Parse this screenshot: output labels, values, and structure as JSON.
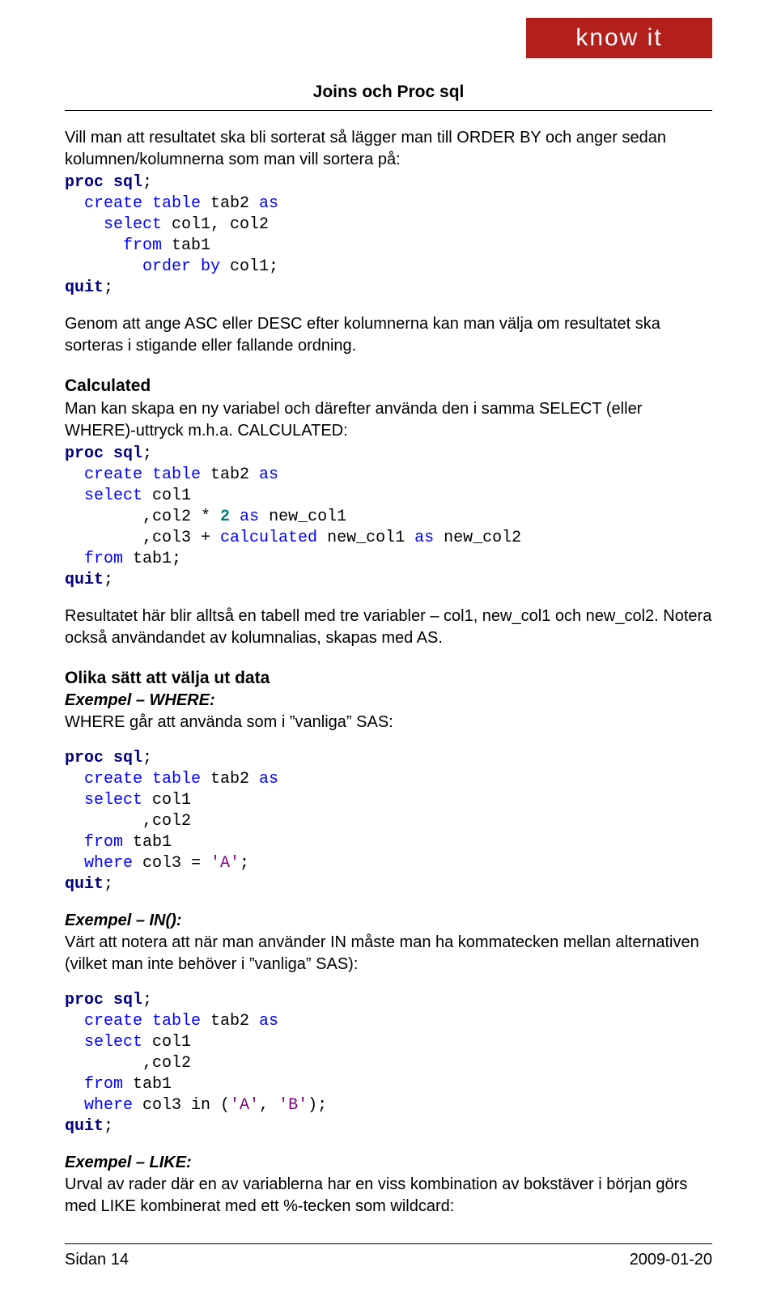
{
  "logo": "know it",
  "header_title": "Joins och Proc sql",
  "intro_para": "Vill man att resultatet ska bli sorterat så lägger man till ORDER BY och anger sedan kolumnen/kolumnerna som man vill sortera på:",
  "code1": {
    "l1a": "proc",
    "l1b": " sql",
    "l1c": ";",
    "l2a": "  create",
    "l2b": " table",
    "l2c": " tab2 ",
    "l2d": "as",
    "l3a": "    select",
    "l3b": " col1, col2",
    "l4a": "      from",
    "l4b": " tab1",
    "l5a": "        order",
    "l5b": " by",
    "l5c": " col1;",
    "l6a": "quit",
    "l6b": ";"
  },
  "para_asc": "Genom att ange ASC eller DESC efter kolumnerna kan man välja om resultatet ska sorteras i stigande eller fallande ordning.",
  "calc_head": "Calculated",
  "calc_para": "Man kan skapa en ny variabel och därefter använda den i samma SELECT (eller WHERE)-uttryck m.h.a. CALCULATED:",
  "code2": {
    "l1a": "proc",
    "l1b": " sql",
    "l1c": ";",
    "l2a": "  create",
    "l2b": " table",
    "l2c": " tab2 ",
    "l2d": "as",
    "l3a": "  select",
    "l3b": " col1",
    "l4a": "        ,col2 * ",
    "l4b": "2",
    "l4c": " as",
    "l4d": " new_col1",
    "l5a": "        ,col3 + ",
    "l5b": "calculated",
    "l5c": " new_col1 ",
    "l5d": "as",
    "l5e": " new_col2",
    "l6a": "  from",
    "l6b": " tab1;",
    "l7a": "quit",
    "l7b": ";"
  },
  "para_result": "Resultatet här blir alltså en tabell med tre variabler – col1, new_col1 och new_col2. Notera också användandet av kolumnalias, skapas med AS.",
  "olika_head": "Olika sätt att välja ut data",
  "ex_where_head": "Exempel – WHERE:",
  "ex_where_para": "WHERE går att använda som i ”vanliga” SAS:",
  "code3": {
    "l1a": "proc",
    "l1b": " sql",
    "l1c": ";",
    "l2a": "  create",
    "l2b": " table",
    "l2c": " tab2 ",
    "l2d": "as",
    "l3a": "  select",
    "l3b": " col1",
    "l4a": "        ,col2",
    "l5a": "  from",
    "l5b": " tab1",
    "l6a": "  where",
    "l6b": " col3 = ",
    "l6c": "'A'",
    "l6d": ";",
    "l7a": "quit",
    "l7b": ";"
  },
  "ex_in_head": "Exempel – IN():",
  "ex_in_para": "Värt att notera att när man använder IN måste man ha kommatecken mellan alternativen (vilket man inte behöver i ”vanliga” SAS):",
  "code4": {
    "l1a": "proc",
    "l1b": " sql",
    "l1c": ";",
    "l2a": "  create",
    "l2b": " table",
    "l2c": " tab2 ",
    "l2d": "as",
    "l3a": "  select",
    "l3b": " col1",
    "l4a": "        ,col2",
    "l5a": "  from",
    "l5b": " tab1",
    "l6a": "  where",
    "l6b": " col3 in (",
    "l6c": "'A'",
    "l6d": ", ",
    "l6e": "'B'",
    "l6f": ");",
    "l7a": "quit",
    "l7b": ";"
  },
  "ex_like_head": "Exempel – LIKE:",
  "ex_like_para": "Urval av rader där en av variablerna har en viss kombination av bokstäver i början görs med LIKE kombinerat med ett %-tecken som wildcard:",
  "footer_left": "Sidan 14",
  "footer_right": "2009-01-20"
}
